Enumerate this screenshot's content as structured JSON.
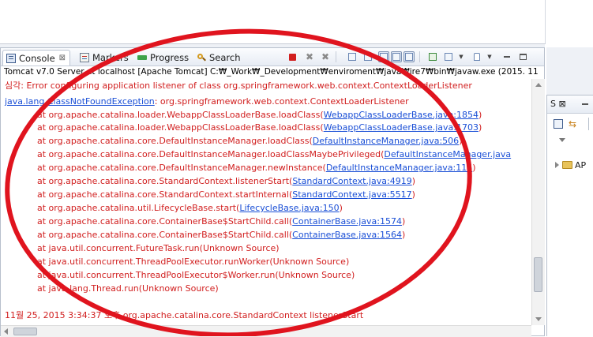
{
  "tabs": [
    {
      "label": "Console",
      "close": "⊠",
      "icon": "console-icon",
      "active": true
    },
    {
      "label": "Markers",
      "icon": "markers-icon",
      "active": false
    },
    {
      "label": "Progress",
      "icon": "progress-icon",
      "active": false
    },
    {
      "label": "Search",
      "icon": "search-icon",
      "active": false
    }
  ],
  "process_title": "Tomcat v7.0 Server at localhost [Apache Tomcat] C:₩_Work₩_Development₩enviroment₩java₩jre7₩bin₩javaw.exe (2015. 11",
  "log": {
    "line1": "심각: Error configuring application listener of class org.springframework.web.context.ContextLoaderListener",
    "line2_link": "java.lang.ClassNotFoundException",
    "line2_text": ": org.springframework.web.context.ContextLoaderListener",
    "trace": [
      {
        "prefix": "at org.apache.catalina.loader.WebappClassLoaderBase.loadClass(",
        "link": "WebappClassLoaderBase.java:1854",
        "suffix": ")"
      },
      {
        "prefix": "at org.apache.catalina.loader.WebappClassLoaderBase.loadClass(",
        "link": "WebappClassLoaderBase.java:1703",
        "suffix": ")"
      },
      {
        "prefix": "at org.apache.catalina.core.DefaultInstanceManager.loadClass(",
        "link": "DefaultInstanceManager.java:506",
        "suffix": ")"
      },
      {
        "prefix": "at org.apache.catalina.core.DefaultInstanceManager.loadClassMaybePrivileged(",
        "link": "DefaultInstanceManager.java",
        "suffix": ""
      },
      {
        "prefix": "at org.apache.catalina.core.DefaultInstanceManager.newInstance(",
        "link": "DefaultInstanceManager.java:115",
        "suffix": ")"
      },
      {
        "prefix": "at org.apache.catalina.core.StandardContext.listenerStart(",
        "link": "StandardContext.java:4919",
        "suffix": ")"
      },
      {
        "prefix": "at org.apache.catalina.core.StandardContext.startInternal(",
        "link": "StandardContext.java:5517",
        "suffix": ")"
      },
      {
        "prefix": "at org.apache.catalina.util.LifecycleBase.start(",
        "link": "LifecycleBase.java:150",
        "suffix": ")"
      },
      {
        "prefix": "at org.apache.catalina.core.ContainerBase$StartChild.call(",
        "link": "ContainerBase.java:1574",
        "suffix": ")"
      },
      {
        "prefix": "at org.apache.catalina.core.ContainerBase$StartChild.call(",
        "link": "ContainerBase.java:1564",
        "suffix": ")"
      },
      {
        "prefix": "at java.util.concurrent.FutureTask.run(Unknown Source)",
        "link": "",
        "suffix": ""
      },
      {
        "prefix": "at java.util.concurrent.ThreadPoolExecutor.runWorker(Unknown Source)",
        "link": "",
        "suffix": ""
      },
      {
        "prefix": "at java.util.concurrent.ThreadPoolExecutor$Worker.run(Unknown Source)",
        "link": "",
        "suffix": ""
      },
      {
        "prefix": "at java.lang.Thread.run(Unknown Source)",
        "link": "",
        "suffix": ""
      }
    ],
    "line_last": "11월 25, 2015 3:34:37 오후 org.apache.catalina.core.StandardContext listenerStart"
  },
  "side_panel": {
    "tab_label": "S ⊠",
    "tree_item": "AP"
  },
  "colors": {
    "error_text": "#d11e1e",
    "link_text": "#1a4fd6",
    "annotation": "#e0141e",
    "stop_button": "#d21f1f"
  }
}
